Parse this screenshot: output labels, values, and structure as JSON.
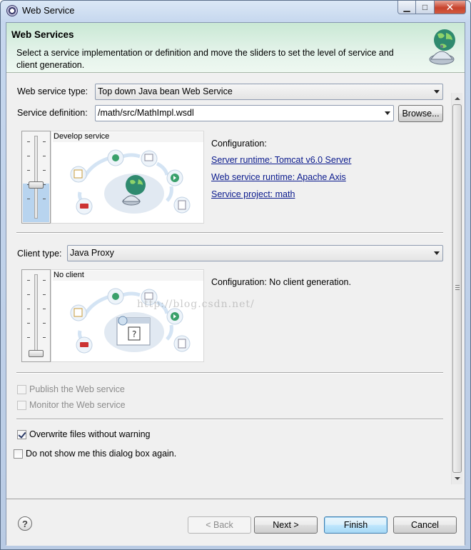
{
  "window": {
    "title": "Web Service"
  },
  "header": {
    "title": "Web Services",
    "description": "Select a service implementation or definition and move the sliders to set the level of service and client generation."
  },
  "service": {
    "type_label": "Web service type:",
    "type_value": "Top down Java bean Web Service",
    "definition_label": "Service definition:",
    "definition_value": "/math/src/MathImpl.wsdl",
    "browse_label": "Browse...",
    "slider_label": "Develop service",
    "slider_level": 0.4,
    "config_title": "Configuration:",
    "links": {
      "server_runtime": "Server runtime: Tomcat v6.0 Server",
      "ws_runtime": "Web service runtime: Apache Axis",
      "service_project": "Service project: math"
    }
  },
  "client": {
    "type_label": "Client type:",
    "type_value": "Java Proxy",
    "slider_label": "No client",
    "slider_level": 0.0,
    "config_text": "Configuration: No client generation."
  },
  "watermark": "http://blog.csdn.net/",
  "options": {
    "publish": {
      "label": "Publish the Web service",
      "checked": false,
      "enabled": false
    },
    "monitor": {
      "label": "Monitor the Web service",
      "checked": false,
      "enabled": false
    },
    "overwrite": {
      "label": "Overwrite files without warning",
      "checked": true,
      "enabled": true
    },
    "do_not_show": {
      "label": "Do not show me this dialog box again.",
      "checked": false,
      "enabled": true
    }
  },
  "footer": {
    "back": "< Back",
    "next": "Next >",
    "finish": "Finish",
    "cancel": "Cancel"
  },
  "colors": {
    "banner": "#c9e8d4",
    "link": "#0a1a8d",
    "close": "#c7432d"
  }
}
